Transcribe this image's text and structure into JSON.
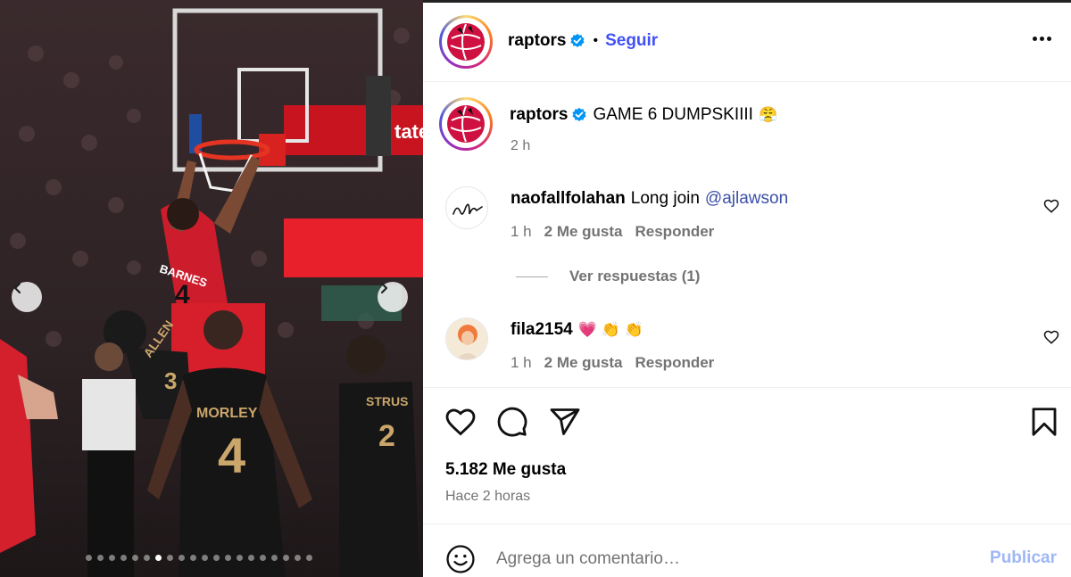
{
  "post": {
    "author": "raptors",
    "follow_label": "Seguir",
    "separator": "•",
    "caption_user": "raptors",
    "caption_text": "GAME 6 DUMPSKIIII",
    "caption_emoji": "😤",
    "caption_time": "2 h"
  },
  "comments": [
    {
      "user": "naofallfolahan",
      "text": "Long join",
      "mention": "@ajlawson",
      "time": "1 h",
      "likes": "2 Me gusta",
      "reply_label": "Responder",
      "view_replies": "Ver respuestas (1)"
    },
    {
      "user": "fila2154",
      "text": "💗 👏 👏",
      "time": "1 h",
      "likes": "2 Me gusta",
      "reply_label": "Responder"
    }
  ],
  "stats": {
    "likes": "5.182 Me gusta",
    "time_ago": "Hace 2 horas"
  },
  "comment_box": {
    "placeholder": "Agrega un comentario…",
    "publish_label": "Publicar"
  },
  "carousel": {
    "slide_count": 20,
    "active_index": 6
  },
  "photo": {
    "jersey_text": [
      "BARNES",
      "ALLEN",
      "MORLEY",
      "STRUS"
    ],
    "jersey_numbers": [
      "4",
      "3",
      "4",
      "2"
    ],
    "banner_text": "tate"
  },
  "colors": {
    "follow_blue": "#4150f7",
    "mention_blue": "#3b4fa9",
    "publish_disabled": "#9fb7f7",
    "muted_gray": "#737373",
    "verified_blue": "#0095f6",
    "raptors_red": "#ce1141"
  },
  "icons": [
    "chevron-left-icon",
    "chevron-right-icon",
    "verified-icon",
    "more-icon",
    "heart-icon",
    "comment-icon",
    "share-icon",
    "bookmark-icon",
    "emoji-icon"
  ]
}
